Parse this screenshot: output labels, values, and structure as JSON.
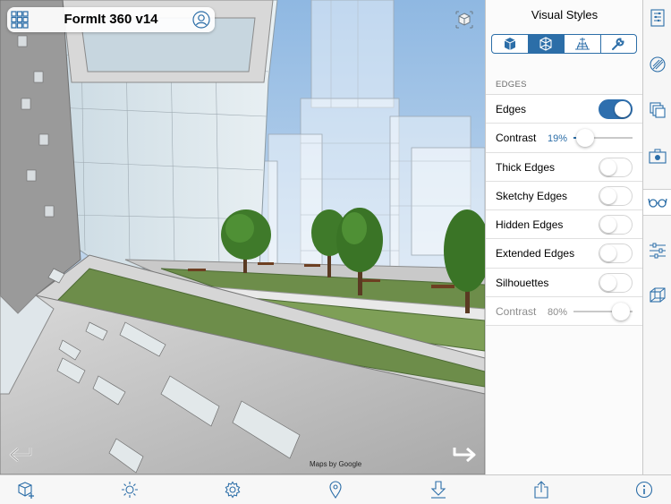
{
  "app": {
    "title": "FormIt 360 v14"
  },
  "viewport": {
    "maps_credit": "Maps by Google"
  },
  "panel": {
    "title": "Visual Styles",
    "tabs": [
      {
        "icon": "solid-cube-icon",
        "active": false
      },
      {
        "icon": "wireframe-cube-icon",
        "active": true
      },
      {
        "icon": "ground-grid-icon",
        "active": false
      },
      {
        "icon": "wrench-icon",
        "active": false
      }
    ],
    "section_label": "EDGES",
    "rows": [
      {
        "label": "Edges",
        "type": "toggle",
        "on": true
      },
      {
        "label": "Contrast",
        "type": "slider",
        "value_text": "19%",
        "value": 0.19
      },
      {
        "label": "Thick Edges",
        "type": "toggle",
        "on": false
      },
      {
        "label": "Sketchy Edges",
        "type": "toggle",
        "on": false
      },
      {
        "label": "Hidden Edges",
        "type": "toggle",
        "on": false
      },
      {
        "label": "Extended Edges",
        "type": "toggle",
        "on": false
      },
      {
        "label": "Silhouettes",
        "type": "toggle",
        "on": false
      },
      {
        "label": "Contrast",
        "type": "slider",
        "value_text": "80%",
        "value": 0.8,
        "disabled": true
      }
    ]
  },
  "rail": [
    {
      "icon": "properties-list-icon",
      "active": false
    },
    {
      "icon": "material-paint-icon",
      "active": false
    },
    {
      "icon": "layers-icon",
      "active": false
    },
    {
      "icon": "scenes-camera-icon",
      "active": false
    },
    {
      "icon": "visual-styles-glasses-icon",
      "active": true
    },
    {
      "icon": "settings-sliders-icon",
      "active": false
    },
    {
      "icon": "groups-cube-icon",
      "active": false
    }
  ],
  "toolbar": [
    "add-cube-icon",
    "sun-icon",
    "settings-gear-icon",
    "location-pin-icon",
    "import-download-icon",
    "share-export-icon",
    "info-icon"
  ],
  "colors": {
    "accent": "#2c6ea8"
  }
}
